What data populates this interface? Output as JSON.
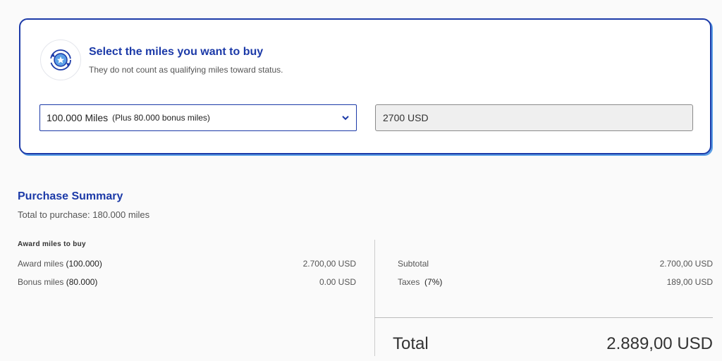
{
  "selector": {
    "title": "Select the miles you want to buy",
    "subtitle": "They do not count as qualifying miles toward status.",
    "icon": "miles-exchange-icon",
    "miles_option": "100.000 Miles",
    "bonus_option": "(Plus 80.000 bonus miles)",
    "price": "2700 USD"
  },
  "summary": {
    "title": "Purchase Summary",
    "total_to_purchase": "Total to purchase: 180.000 miles",
    "section_label": "Award miles to buy",
    "left_rows": [
      {
        "label": "Award miles",
        "qty": "(100.000)",
        "value": "2.700,00 USD"
      },
      {
        "label": "Bonus miles",
        "qty": "(80.000)",
        "value": "0.00 USD"
      }
    ],
    "right_rows": [
      {
        "label": "Subtotal",
        "qty": "",
        "value": "2.700,00 USD"
      },
      {
        "label": "Taxes",
        "qty": "(7%)",
        "value": "189,00 USD"
      }
    ],
    "total_label": "Total",
    "total_value": "2.889,00 USD"
  },
  "colors": {
    "accent": "#1c3aa8",
    "accent_light": "#5b9fe6"
  }
}
